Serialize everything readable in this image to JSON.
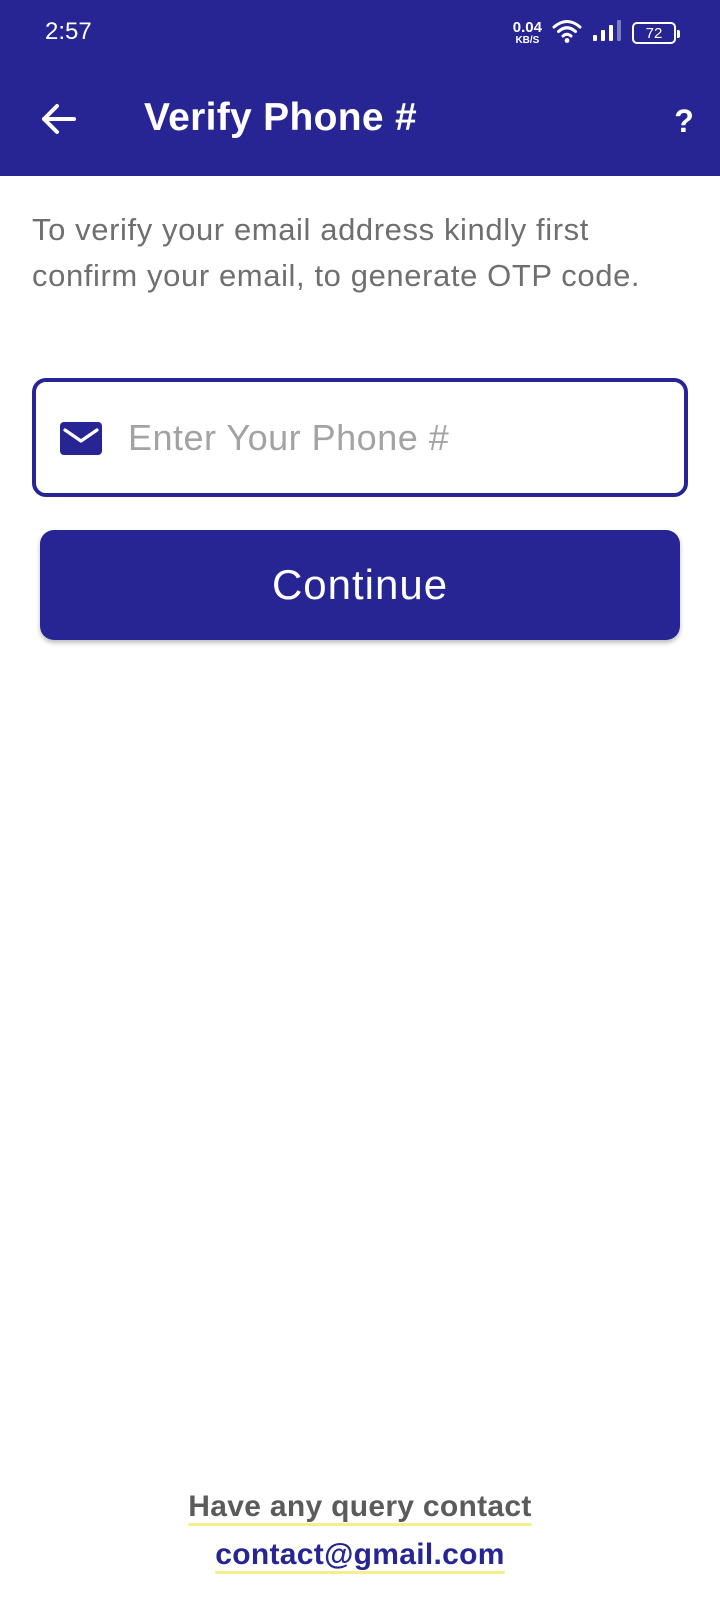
{
  "status_bar": {
    "time": "2:57",
    "net_speed_value": "0.04",
    "net_speed_unit": "KB/S",
    "battery_level": "72",
    "icons": [
      "wifi-icon",
      "signal-icon",
      "battery-icon"
    ]
  },
  "app_bar": {
    "title": "Verify Phone #",
    "back_icon": "arrow-left-icon",
    "help_label": "?"
  },
  "main": {
    "instructions": "To verify your email address kindly first confirm your email, to generate OTP code.",
    "phone_field": {
      "placeholder": "Enter Your Phone #",
      "value": "",
      "icon": "mail-icon"
    },
    "continue_label": "Continue"
  },
  "footer": {
    "query_text": "Have any query contact",
    "contact_email": "contact@gmail.com"
  },
  "colors": {
    "primary": "#272594",
    "text_muted": "#6f6f6f",
    "placeholder": "#a3a3a3",
    "underline_highlight": "#f4ef8c"
  }
}
